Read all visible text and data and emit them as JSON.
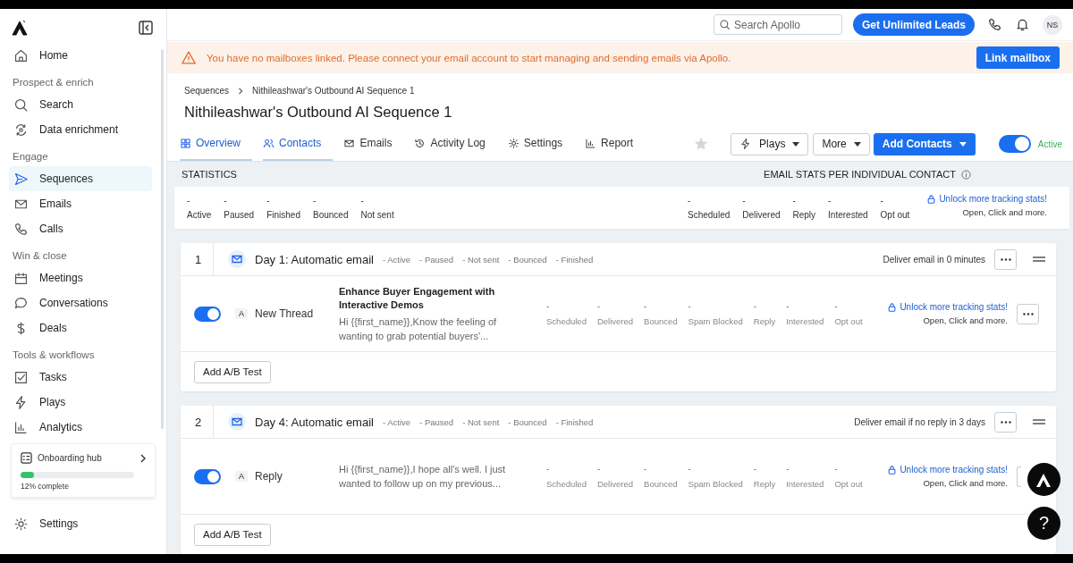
{
  "sidebar": {
    "sections": [
      {
        "items": [
          {
            "label": "Home",
            "selected": false
          }
        ]
      },
      {
        "heading": "Prospect & enrich",
        "items": [
          {
            "label": "Search",
            "selected": false
          },
          {
            "label": "Data enrichment",
            "selected": false
          }
        ]
      },
      {
        "heading": "Engage",
        "items": [
          {
            "label": "Sequences",
            "selected": true
          },
          {
            "label": "Emails",
            "selected": false
          },
          {
            "label": "Calls",
            "selected": false
          }
        ]
      },
      {
        "heading": "Win & close",
        "items": [
          {
            "label": "Meetings",
            "selected": false
          },
          {
            "label": "Conversations",
            "selected": false
          },
          {
            "label": "Deals",
            "selected": false
          }
        ]
      },
      {
        "heading": "Tools & workflows",
        "items": [
          {
            "label": "Tasks",
            "selected": false
          },
          {
            "label": "Plays",
            "selected": false
          },
          {
            "label": "Analytics",
            "selected": false
          }
        ]
      }
    ],
    "onboarding": {
      "title": "Onboarding hub",
      "level": 0.12,
      "reading": "12% complete"
    },
    "footer_item": {
      "label": "Settings"
    }
  },
  "header": {
    "search": {
      "placeholder": "Search Apollo"
    },
    "cta": "Get Unlimited Leads",
    "avatar": "NS"
  },
  "banner": {
    "message": "You have no mailboxes linked. Please connect your email account to start managing and sending emails via Apollo.",
    "button": "Link mailbox"
  },
  "breadcrumb": [
    "Sequences",
    "Nithileashwar's Outbound AI Sequence 1"
  ],
  "title": "Nithileashwar's Outbound AI Sequence 1",
  "tabs": [
    {
      "label": "Overview",
      "selected": true
    },
    {
      "label": "Contacts",
      "selected": true
    },
    {
      "label": "Emails",
      "selected": false
    },
    {
      "label": "Activity Log",
      "selected": false
    },
    {
      "label": "Settings",
      "selected": false
    },
    {
      "label": "Report",
      "selected": false
    }
  ],
  "actions": {
    "starred": false,
    "plays": "Plays",
    "more": "More",
    "add": "Add Contacts",
    "active": {
      "on": true,
      "label": "Active"
    }
  },
  "statistics": {
    "title": "STATISTICS",
    "per_contact_title": "EMAIL STATS PER INDIVIDUAL CONTACT",
    "left": [
      {
        "value": "-",
        "label": "Active"
      },
      {
        "value": "-",
        "label": "Paused"
      },
      {
        "value": "-",
        "label": "Finished"
      },
      {
        "value": "-",
        "label": "Bounced"
      },
      {
        "value": "-",
        "label": "Not sent"
      }
    ],
    "right": [
      {
        "value": "-",
        "label": "Scheduled"
      },
      {
        "value": "-",
        "label": "Delivered"
      },
      {
        "value": "-",
        "label": "Reply"
      },
      {
        "value": "-",
        "label": "Interested"
      },
      {
        "value": "-",
        "label": "Opt out"
      }
    ],
    "unlock": "Unlock more tracking stats!",
    "unlock_note": "Open, Click and more."
  },
  "steps": [
    {
      "number": "1",
      "title": "Day 1: Automatic email",
      "statuses": [
        "- Active",
        "- Paused",
        "- Not sent",
        "- Bounced",
        "- Finished"
      ],
      "delivery": "Deliver email in 0 minutes",
      "on": true,
      "variant": "A",
      "thread": "New Thread",
      "subject": "Enhance Buyer Engagement with Interactive Demos",
      "preview": "Hi {{first_name}},Know the feeling of wanting to grab potential buyers'...",
      "stats": [
        {
          "value": "-",
          "label": "Scheduled"
        },
        {
          "value": "-",
          "label": "Delivered"
        },
        {
          "value": "-",
          "label": "Bounced"
        },
        {
          "value": "-",
          "label": "Spam Blocked"
        },
        {
          "value": "-",
          "label": "Reply"
        },
        {
          "value": "-",
          "label": "Interested"
        },
        {
          "value": "-",
          "label": "Opt out"
        }
      ],
      "unlock": "Unlock more tracking stats!",
      "unlock_note": "Open, Click and more.",
      "ab_button": "Add A/B Test"
    },
    {
      "number": "2",
      "title": "Day 4: Automatic email",
      "statuses": [
        "- Active",
        "- Paused",
        "- Not sent",
        "- Bounced",
        "- Finished"
      ],
      "delivery": "Deliver email if no reply in 3 days",
      "on": true,
      "variant": "A",
      "thread": "Reply",
      "preview": "Hi {{first_name}},I hope all's well. I just wanted to follow up on my previous...",
      "stats": [
        {
          "value": "-",
          "label": "Scheduled"
        },
        {
          "value": "-",
          "label": "Delivered"
        },
        {
          "value": "-",
          "label": "Bounced"
        },
        {
          "value": "-",
          "label": "Spam Blocked"
        },
        {
          "value": "-",
          "label": "Reply"
        },
        {
          "value": "-",
          "label": "Interested"
        },
        {
          "value": "-",
          "label": "Opt out"
        }
      ],
      "unlock": "Unlock more tracking stats!",
      "unlock_note": "Open, Click and more.",
      "ab_button": "Add A/B Test"
    }
  ],
  "help": "?"
}
